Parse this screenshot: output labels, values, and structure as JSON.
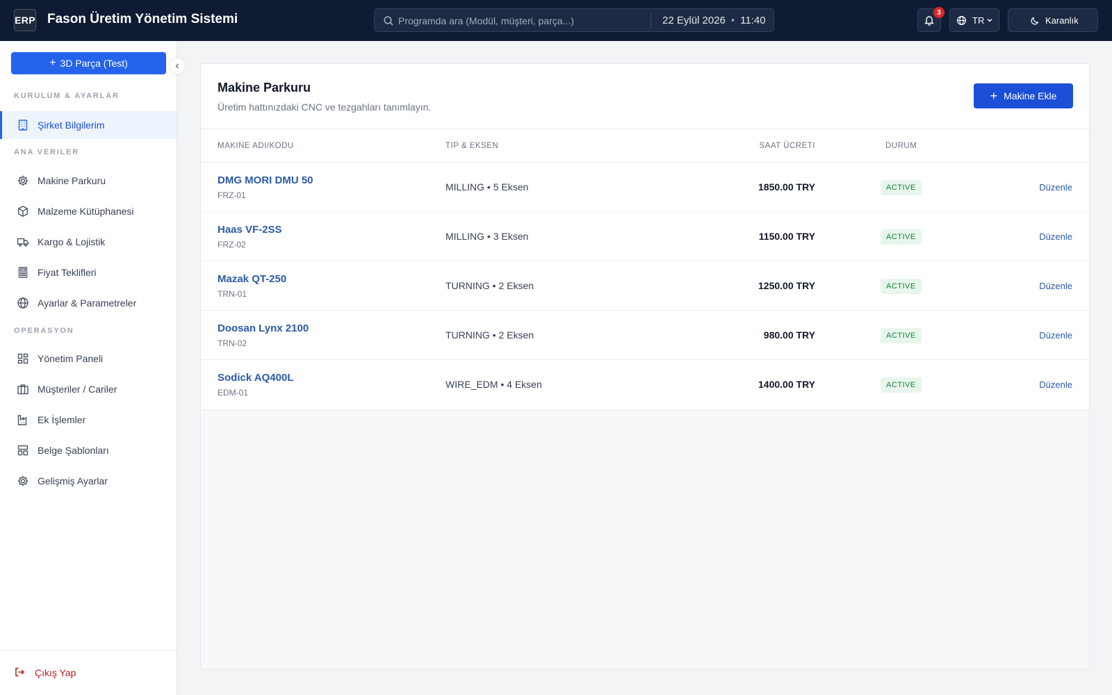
{
  "header": {
    "logo": "ERP",
    "title": "Fason Üretim Yönetim Sistemi",
    "search_placeholder": "Programda ara (Modül, müşteri, parça...)",
    "date": "22 Eylül 2026",
    "time": "11:40",
    "notification_count": "3",
    "language": "TR",
    "theme_label": "Karanlık"
  },
  "sidebar": {
    "new_part_label": "3D Parça (Test)",
    "sections": [
      {
        "label": "KURULUM & AYARLAR"
      },
      {
        "label": "ANA VERILER"
      },
      {
        "label": "OPERASYON"
      }
    ],
    "items": [
      {
        "label": "Şirket Bilgilerim",
        "icon": "building-icon",
        "active": true
      },
      {
        "label": "Makine Parkuru",
        "icon": "gear-icon"
      },
      {
        "label": "Malzeme Kütüphanesi",
        "icon": "box-icon"
      },
      {
        "label": "Kargo & Lojistik",
        "icon": "truck-icon"
      },
      {
        "label": "Fiyat Teklifleri",
        "icon": "calculator-icon"
      },
      {
        "label": "Ayarlar & Parametreler",
        "icon": "globe-icon"
      },
      {
        "label": "Yönetim Paneli",
        "icon": "dashboard-icon"
      },
      {
        "label": "Müşteriler / Cariler",
        "icon": "briefcase-icon"
      },
      {
        "label": "Ek İşlemler",
        "icon": "factory-icon"
      },
      {
        "label": "Belge Şablonları",
        "icon": "template-icon"
      },
      {
        "label": "Gelişmiş Ayarlar",
        "icon": "gear-icon"
      }
    ],
    "logout_label": "Çıkış Yap"
  },
  "main": {
    "title": "Makine Parkuru",
    "subtitle": "Üretim hattınızdaki CNC ve tezgahları tanımlayın.",
    "add_button_label": "Makine Ekle",
    "columns": [
      "MAKINE ADI/KODU",
      "TIP & EKSEN",
      "SAAT ÜCRETI",
      "DURUM"
    ],
    "machines": [
      {
        "name": "DMG MORI DMU 50",
        "code": "FRZ-01",
        "type": "MILLING",
        "axes": "5 Eksen",
        "rate": "1850.00 TRY",
        "status": "ACTIVE",
        "action": "Düzenle"
      },
      {
        "name": "Haas VF-2SS",
        "code": "FRZ-02",
        "type": "MILLING",
        "axes": "3 Eksen",
        "rate": "1150.00 TRY",
        "status": "ACTIVE",
        "action": "Düzenle"
      },
      {
        "name": "Mazak QT-250",
        "code": "TRN-01",
        "type": "TURNING",
        "axes": "2 Eksen",
        "rate": "1250.00 TRY",
        "status": "ACTIVE",
        "action": "Düzenle"
      },
      {
        "name": "Doosan Lynx 2100",
        "code": "TRN-02",
        "type": "TURNING",
        "axes": "2 Eksen",
        "rate": "980.00 TRY",
        "status": "ACTIVE",
        "action": "Düzenle"
      },
      {
        "name": "Sodick AQ400L",
        "code": "EDM-01",
        "type": "WIRE_EDM",
        "axes": "4 Eksen",
        "rate": "1400.00 TRY",
        "status": "ACTIVE",
        "action": "Düzenle"
      }
    ]
  },
  "colors": {
    "topbar": "#0f1b33",
    "primary": "#2563eb",
    "link": "#2b5aa8",
    "status_active": "#15803d",
    "logout": "#b91c1c"
  }
}
